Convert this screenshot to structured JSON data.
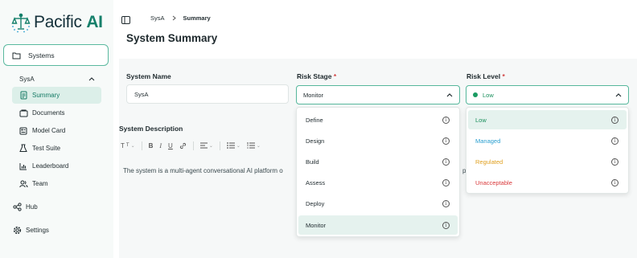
{
  "brand": {
    "name_main": "Pacific",
    "name_ai": "AI"
  },
  "sidebar": {
    "systems_label": "Systems",
    "system_name": "SysA",
    "sub_items": [
      {
        "label": "Summary",
        "icon": "document-icon",
        "active": true
      },
      {
        "label": "Documents",
        "icon": "documents-icon"
      },
      {
        "label": "Model Card",
        "icon": "card-icon"
      },
      {
        "label": "Test Suite",
        "icon": "flask-icon"
      },
      {
        "label": "Leaderboard",
        "icon": "bar-chart-icon"
      },
      {
        "label": "Team",
        "icon": "users-icon"
      }
    ],
    "hub_label": "Hub",
    "settings_label": "Settings"
  },
  "breadcrumb": {
    "system": "SysA",
    "current": "Summary"
  },
  "page_title": "System Summary",
  "form": {
    "system_name_label": "System Name",
    "system_name_value": "SysA",
    "risk_stage_label": "Risk Stage",
    "risk_stage_value": "Monitor",
    "risk_level_label": "Risk Level",
    "risk_level_value": "Low",
    "required_mark": "*",
    "description_label": "System Description",
    "description_text": "The system is a multi-agent conversational AI platform o",
    "description_tail": "p"
  },
  "risk_stage_options": [
    "Define",
    "Design",
    "Build",
    "Assess",
    "Deploy",
    "Monitor"
  ],
  "risk_level_options": [
    {
      "label": "Low",
      "color": "#1a8f5c"
    },
    {
      "label": "Managed",
      "color": "#2a9fd0"
    },
    {
      "label": "Regulated",
      "color": "#e0a020"
    },
    {
      "label": "Unacceptable",
      "color": "#d9383a"
    }
  ],
  "toolbar": {
    "text_style": "T",
    "bold": "B",
    "italic": "I",
    "underline": "U"
  },
  "colors": {
    "accent": "#16806b",
    "accent_border": "#56b79c",
    "selected_bg": "#e5f2ee"
  }
}
